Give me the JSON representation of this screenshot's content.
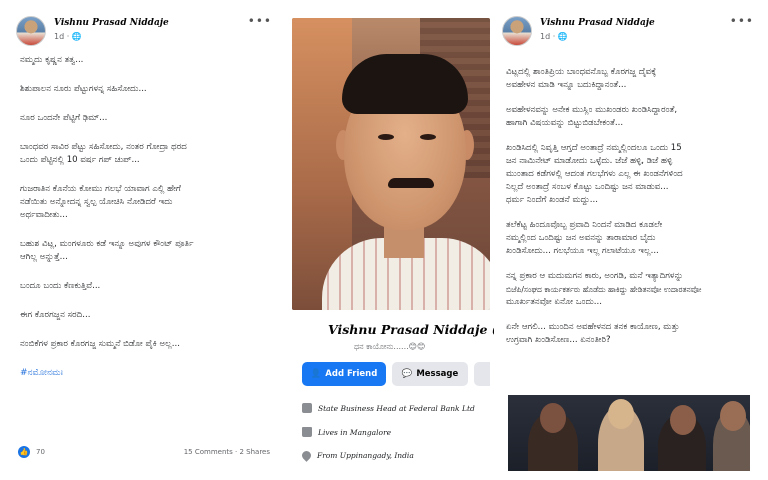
{
  "left_post": {
    "author": "Vishnu Prasad Niddaje",
    "meta": "1d · 🌐",
    "menu": "•••",
    "lines": [
      "ನಮ್ಮದು ಕೃಷ್ಣನ ತತ್ವ...",
      "ಶಿಶುಪಾಲನ ನೂರು ಪೆಟ್ಟುಗಳನ್ನ ಸಹಿಸೋದು...",
      "ನೂರ ಒಂದನೇ ಪೆಟ್ಟಿಗೆ ಢಿಮ್...",
      "ಬಾಂಧವರ ಸಾವಿರ ಪೆಟ್ಟು ಸಹಿಸೋದು, ನಂತರ ಗೋದ್ರಾ ಥರದ",
      "ಒಂದು ಪೆಟ್ಟಿನಲ್ಲಿ 10 ವರ್ಷ ಗಪ್ ಚುಪ್...",
      "ಗುಜರಾತಿನ ಕೊನೆಯ ಕೋಮು ಗಲಭೆ ಯಾವಾಗ ಎಲ್ಲಿ ಹೇಗೆ",
      "ನಡೆಯಿತು ಅನ್ನೋದನ್ನ ಸ್ವಲ್ಪ ಯೋಚಿಸಿ ನೋಡಿದರೆ ಇದು",
      "ಅರ್ಥವಾದೀತು...",
      "ಬಹುಶ ವಿಟ್ಲ, ಮಂಗಳೂರು ಕಡೆ ಇನ್ನೂ ಅವುಗಳ ಕೌಂಟ್ ಪೂರ್ತಿ",
      "ಆಗಿಲ್ಲ ಅನ್ನುತ್ತೆ...",
      "ಬಂದೂ ಬಂದು ಕೆಣಕುತ್ತಿವೆ...",
      "ಈಗ ಕೊರಗಜ್ಜನ ಸರದಿ...",
      "ನಂಬಿಕೆಗಳ ಪ್ರಕಾರ ಕೊರಗಜ್ಜ ಸುಮ್ಮನೆ ಬಿಡೋ ಪೈಕಿ ಅಲ್ಲ..."
    ],
    "hashtag": "#ನಮೋನಮಃ",
    "likes": "70",
    "stats": "15 Comments · 2 Shares"
  },
  "profile": {
    "name": "Vishnu Prasad Niddaje (ವಿಪ್ರನಿ)",
    "subtitle": "ಧನ ಕಾಯೋನು......😊😊",
    "add_friend_label": "Add Friend",
    "message_label": "Message",
    "intro": [
      {
        "icon": "briefcase-icon",
        "text": "State Business Head at Federal Bank Ltd"
      },
      {
        "icon": "home-icon",
        "text": "Lives in Mangalore"
      },
      {
        "icon": "location-pin-icon",
        "text": "From Uppinangady, India"
      }
    ]
  },
  "right_post": {
    "author": "Vishnu Prasad Niddaje",
    "meta": "1d · 🌐",
    "menu": "•••",
    "lines": [
      "ವಿಟ್ಲದಲ್ಲಿ ಶಾಂತಿಪ್ರಿಯ ಬಾಂಧವನೊಬ್ಬ ಕೊರಗಜ್ಜ ದೈವಕ್ಕೆ",
      "ಅವಹೇಳನ ಮಾಡಿ ಇನ್ನೂ ಬದುಕಿದ್ದಾನಂತೆ...",
      "ಅವಹೇಳನವನ್ನು ಅನೇಕ ಮುಸ್ಲಿಂ ಮುಖಂಡರು ಖಂಡಿಸಿದ್ದಾರಂತೆ,",
      "ಹಾಗಾಗಿ ವಿಷಯವನ್ನು ಬಿಟ್ಟುಬಿಡಬೇಕಂತೆ...",
      "ಖಂಡಿಸಿದಲ್ಲಿ ನಿವೃತ್ತಿ ಆಗ್ತದೆ ಅಂತಾದ್ರೆ ನಮ್ಮಲ್ಲಿಂದಲೂ ಒಂದು 15",
      "ಜನ ನಾಮಿನೇಟ್ ಮಾಡೋದು ಒಳ್ಳೆದು. ಜೆಜೆ ಹಳ್ಳಿ, ಡಿಜೆ ಹಳ್ಳಿ",
      "ಮುಂತಾದ ಕಡೆಗಳಲ್ಲಿ ಆದಂತ ಗಲಭೆಗಳು ಎಲ್ಲ ಈ ಖಂಡನೆಗಳಿಂದ",
      "ನಿಲ್ಲದೆ ಅಂತಾದ್ರೆ ಸಂಬಳ ಕೊಟ್ಟು ಒಂದಿಷ್ಟು ಜನ ಮಾಡುವ...",
      "ಧರ್ಮ ನಿಂದೆಗೆ ಖಂಡನೆ ಮದ್ದು...",
      "ತಲೆಕೆಟ್ಟ ಹಿಂದೂವೊಬ್ಬ ಪ್ರವಾದಿ ನಿಂದನೆ ಮಾಡಿದ ಕೂಡಲೇ",
      "ನಮ್ಮಲ್ಲಿಂದ ಒಂದಿಷ್ಟು ಜನ ಅವನನ್ನು ತಾರಾಮಾರ ಬೈದು",
      "ಖಂಡಿಸೋದು... ಗಲಭೆಯೂ ಇಲ್ಲ ಗಲಾಟೆಯೂ ಇಲ್ಲ...",
      "ನನ್ನ ಪ್ರಕಾರ ಆ ಮದುಮಗನ ಕಾರು, ಅಂಗಡಿ, ಮನೆ ಇತ್ಯಾದಿಗಳನ್ನು",
      "ಬಿಜೆಪಿ/ಸಂಘದ ಕಾರ್ಯಕರ್ತರು ಹೊಡೆದು ಹಾಕಿದ್ದು ಹೇಡಿತನವೋ ಉದಾರತನವೋ",
      "ಮೂರ್ಖತನವೋ ಏನೋ ಒಂದು...",
      "ಏನೇ ಆಗಲಿ... ಮುಂದಿನ ಅವಹೇಳನದ ತನಕ ಕಾಯೋಣ, ಮತ್ತು",
      "ಉಗ್ರವಾಗಿ ಖಂಡಿಸೋಣ... ಏನಂತೀರಿ?"
    ]
  }
}
